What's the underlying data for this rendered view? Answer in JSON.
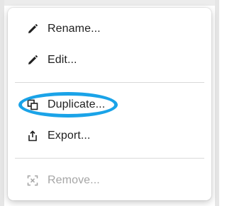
{
  "menu": {
    "items": [
      {
        "label": "Rename...",
        "icon": "pencil-icon",
        "enabled": true
      },
      {
        "label": "Edit...",
        "icon": "pencil-icon",
        "enabled": true
      },
      {
        "label": "Duplicate...",
        "icon": "duplicate-icon",
        "enabled": true,
        "highlighted": true
      },
      {
        "label": "Export...",
        "icon": "export-icon",
        "enabled": true
      },
      {
        "label": "Remove...",
        "icon": "remove-icon",
        "enabled": false
      }
    ]
  },
  "colors": {
    "text": "#1f1f1f",
    "disabled_text": "#a5a5a5",
    "divider": "#d9d9d9",
    "highlight_ring": "#1aa3e8"
  }
}
